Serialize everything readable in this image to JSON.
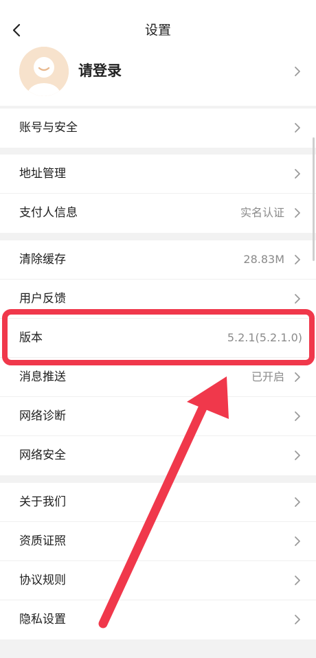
{
  "header": {
    "title": "设置",
    "back_icon": "chevron-left-icon"
  },
  "profile": {
    "login_label": "请登录",
    "avatar_icon": "default-user-avatar",
    "avatar_color": "#f7e2cc"
  },
  "sections": [
    {
      "rows": [
        {
          "label": "账号与安全",
          "value": ""
        }
      ]
    },
    {
      "rows": [
        {
          "label": "地址管理",
          "value": ""
        },
        {
          "label": "支付人信息",
          "value": "实名认证"
        }
      ]
    },
    {
      "rows": [
        {
          "label": "清除缓存",
          "value": "28.83M"
        },
        {
          "label": "用户反馈",
          "value": ""
        },
        {
          "label": "版本",
          "value": "5.2.1(5.2.1.0)"
        },
        {
          "label": "消息推送",
          "value": "已开启"
        },
        {
          "label": "网络诊断",
          "value": ""
        },
        {
          "label": "网络安全",
          "value": ""
        }
      ]
    },
    {
      "rows": [
        {
          "label": "关于我们",
          "value": ""
        },
        {
          "label": "资质证照",
          "value": ""
        },
        {
          "label": "协议规则",
          "value": ""
        },
        {
          "label": "隐私设置",
          "value": ""
        }
      ]
    }
  ],
  "annotation": {
    "highlight_color": "#f0384b",
    "arrow_color": "#f0384b"
  }
}
